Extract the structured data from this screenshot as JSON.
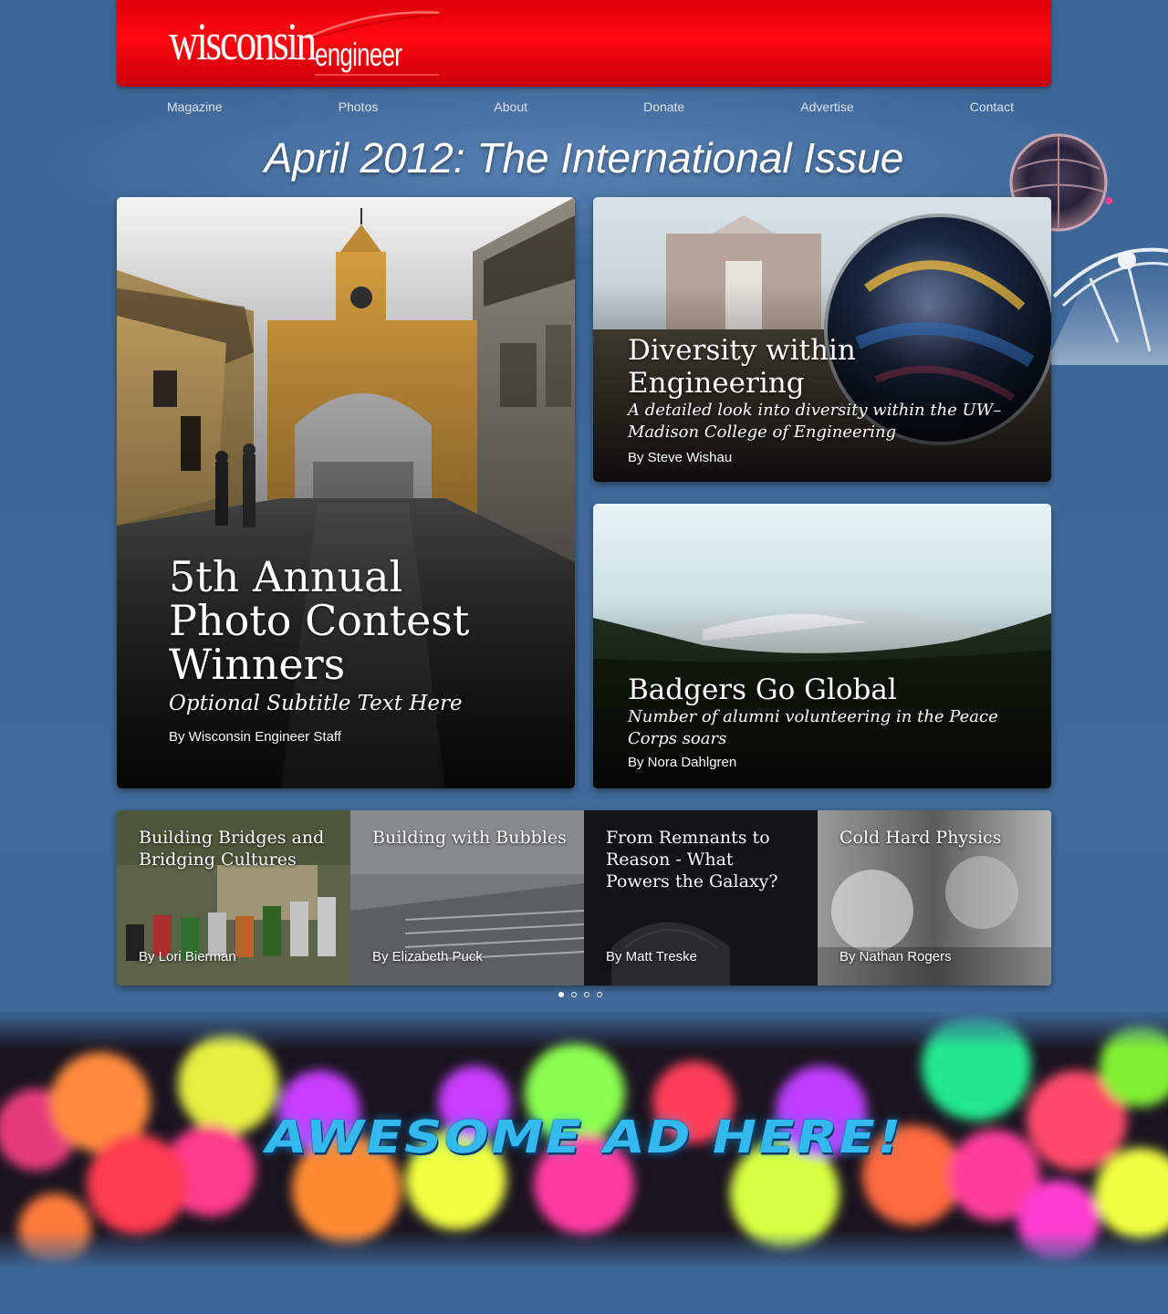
{
  "header": {
    "logo_main": "wisconsin",
    "logo_sub": "engineer",
    "brand_color": "#ff0000"
  },
  "nav": {
    "items": [
      "Magazine",
      "Photos",
      "About",
      "Donate",
      "Advertise",
      "Contact"
    ]
  },
  "issue": {
    "title": "April 2012: The International Issue"
  },
  "features": [
    {
      "title": "5th Annual Photo Contest Winners",
      "subtitle": "Optional Subtitle Text Here",
      "byline": "By Wisconsin Engineer Staff"
    },
    {
      "title": "Diversity within Engineering",
      "subtitle": "A detailed look into diversity within the UW–Madison College of Engineering",
      "byline": "By Steve Wishau"
    },
    {
      "title": "Badgers Go Global",
      "subtitle": "Number of alumni volunteering in the Peace Corps soars",
      "byline": "By Nora Dahlgren"
    }
  ],
  "carousel": {
    "slides": [
      {
        "title": "Building Bridges and Bridging Cultures",
        "byline": "By Lori Bierman"
      },
      {
        "title": "Building with Bubbles",
        "byline": "By Elizabeth Puck"
      },
      {
        "title": "From Remnants to Reason - What Powers the Galaxy?",
        "byline": "By Matt Treske"
      },
      {
        "title": "Cold Hard Physics",
        "byline": "By Nathan Rogers"
      }
    ],
    "page_count": 4,
    "active_page": 1
  },
  "ad": {
    "text": "AWESOME AD HERE!"
  }
}
